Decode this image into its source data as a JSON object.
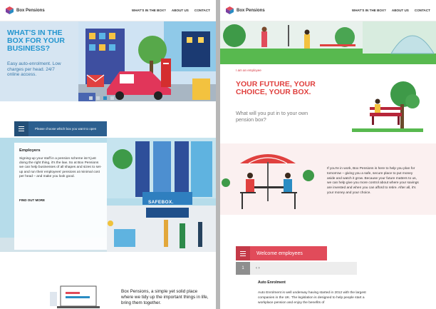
{
  "brand": {
    "name": "Box Pensions",
    "colors": {
      "left_accent": "#2596cf",
      "right_accent": "#e0413f"
    }
  },
  "nav": {
    "items": [
      "WHAT'S IN THE BOX?",
      "ABOUT US",
      "CONTACT"
    ]
  },
  "left": {
    "hero": {
      "title": "WHAT'S IN THE BOX FOR YOUR BUSINESS?",
      "subtitle": "Easy auto-enrolment. Low charges per head. 24/7 online access.",
      "carousel_total": 4,
      "carousel_active": 2
    },
    "chooser_label": "Please choose which box you want to open",
    "employers": {
      "title": "Employers",
      "body": "Signing-up your staff in a pension scheme isn't just doing the right thing, it's the law. So at Box Pensions we can help businesses of all shapes and sizes to set-up and run their employees' pensions at minimal cost per head – and make you look good.",
      "link": "FIND OUT MORE"
    },
    "illustration_sign": "SAFEBOX.",
    "bottom_text": "Box Pensions, a simple yet solid place where we tidy up the important things in life, bring them together."
  },
  "right": {
    "eyebrow": "I am an employee",
    "title": "YOUR FUTURE, YOUR CHOICE, YOUR BOX.",
    "subtitle": "What will you put in to your own pension box?",
    "paragraph": "If you're in work, Box Pensions is here to help you plan for tomorrow – giving you a safe, secure place to put money aside and watch it grow. Because your future matters to us, we can help give you more control about where your savings are invested and when you can afford to retire. After all, it's your money and your choice.",
    "welcome_label": "Welcome employees",
    "step_number": "1",
    "step_arrows": "‹ ›",
    "auto_heading": "Auto Enrolment",
    "auto_text": "Auto Enrolment is well underway having started in 2012 with the largest companies in the UK. The legislation is designed to help people start a workplace pension and enjoy the benefits of"
  }
}
